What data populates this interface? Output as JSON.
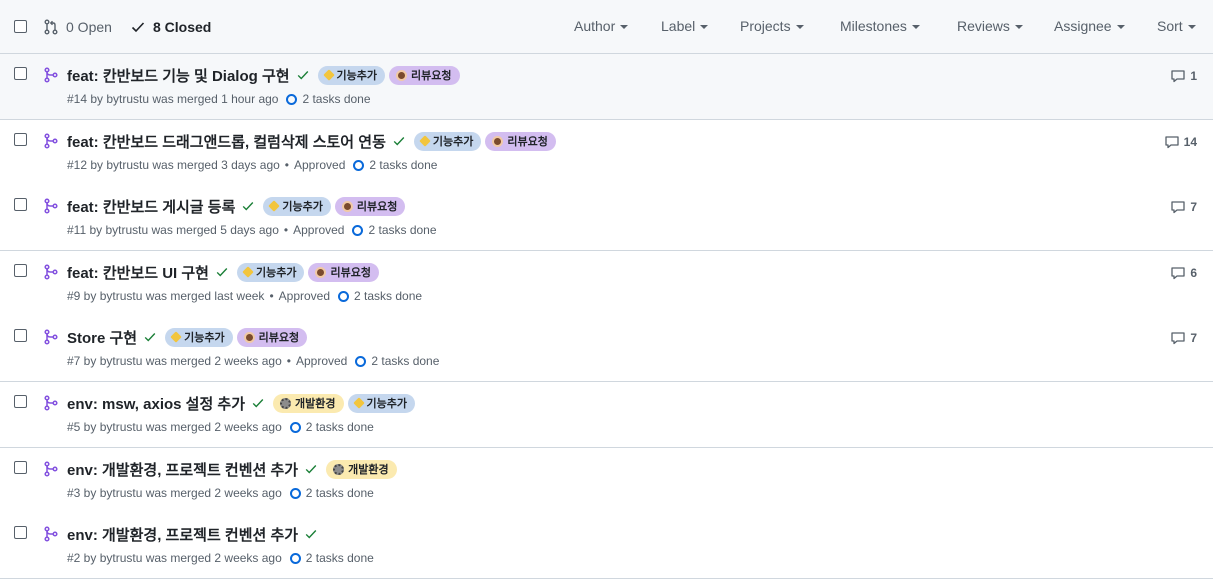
{
  "header": {
    "open_label": "0 Open",
    "closed_label": "8 Closed",
    "filters": [
      "Author",
      "Label",
      "Projects",
      "Milestones",
      "Reviews",
      "Assignee",
      "Sort"
    ]
  },
  "labels": {
    "feature": "기능추가",
    "review": "리뷰요청",
    "env": "개발환경"
  },
  "colors": {
    "merged_purple": "#8250df",
    "check_green": "#1a7f37",
    "link_blue": "#0969da",
    "label_feature": "#c5d7ee",
    "label_review": "#d3bdf0",
    "label_env": "#fbeab0"
  },
  "pulls": [
    {
      "title": "feat: 칸반보드 기능 및 Dialog 구현",
      "labels": [
        "feature",
        "review"
      ],
      "meta": "#14 by bytrustu was merged 1 hour ago",
      "approved": "",
      "tasks": "2 tasks done",
      "comments": "1"
    },
    {
      "title": "feat: 칸반보드 드래그앤드롭, 컬럼삭제 스토어 연동",
      "labels": [
        "feature",
        "review"
      ],
      "meta": "#12 by bytrustu was merged 3 days ago",
      "approved": "Approved",
      "tasks": "2 tasks done",
      "comments": "14"
    },
    {
      "title": "feat: 칸반보드 게시글 등록",
      "labels": [
        "feature",
        "review"
      ],
      "meta": "#11 by bytrustu was merged 5 days ago",
      "approved": "Approved",
      "tasks": "2 tasks done",
      "comments": "7"
    },
    {
      "title": "feat: 칸반보드 UI 구현",
      "labels": [
        "feature",
        "review"
      ],
      "meta": "#9 by bytrustu was merged last week",
      "approved": "Approved",
      "tasks": "2 tasks done",
      "comments": "6"
    },
    {
      "title": "Store 구현",
      "labels": [
        "feature",
        "review"
      ],
      "meta": "#7 by bytrustu was merged 2 weeks ago",
      "approved": "Approved",
      "tasks": "2 tasks done",
      "comments": "7"
    },
    {
      "title": "env: msw, axios 설정 추가",
      "labels": [
        "env",
        "feature"
      ],
      "meta": "#5 by bytrustu was merged 2 weeks ago",
      "approved": "",
      "tasks": "2 tasks done",
      "comments": ""
    },
    {
      "title": "env: 개발환경, 프로젝트 컨벤션 추가",
      "labels": [
        "env"
      ],
      "meta": "#3 by bytrustu was merged 2 weeks ago",
      "approved": "",
      "tasks": "2 tasks done",
      "comments": ""
    },
    {
      "title": "env: 개발환경, 프로젝트 컨벤션 추가",
      "labels": [],
      "meta": "#2 by bytrustu was merged 2 weeks ago",
      "approved": "",
      "tasks": "2 tasks done",
      "comments": ""
    }
  ]
}
